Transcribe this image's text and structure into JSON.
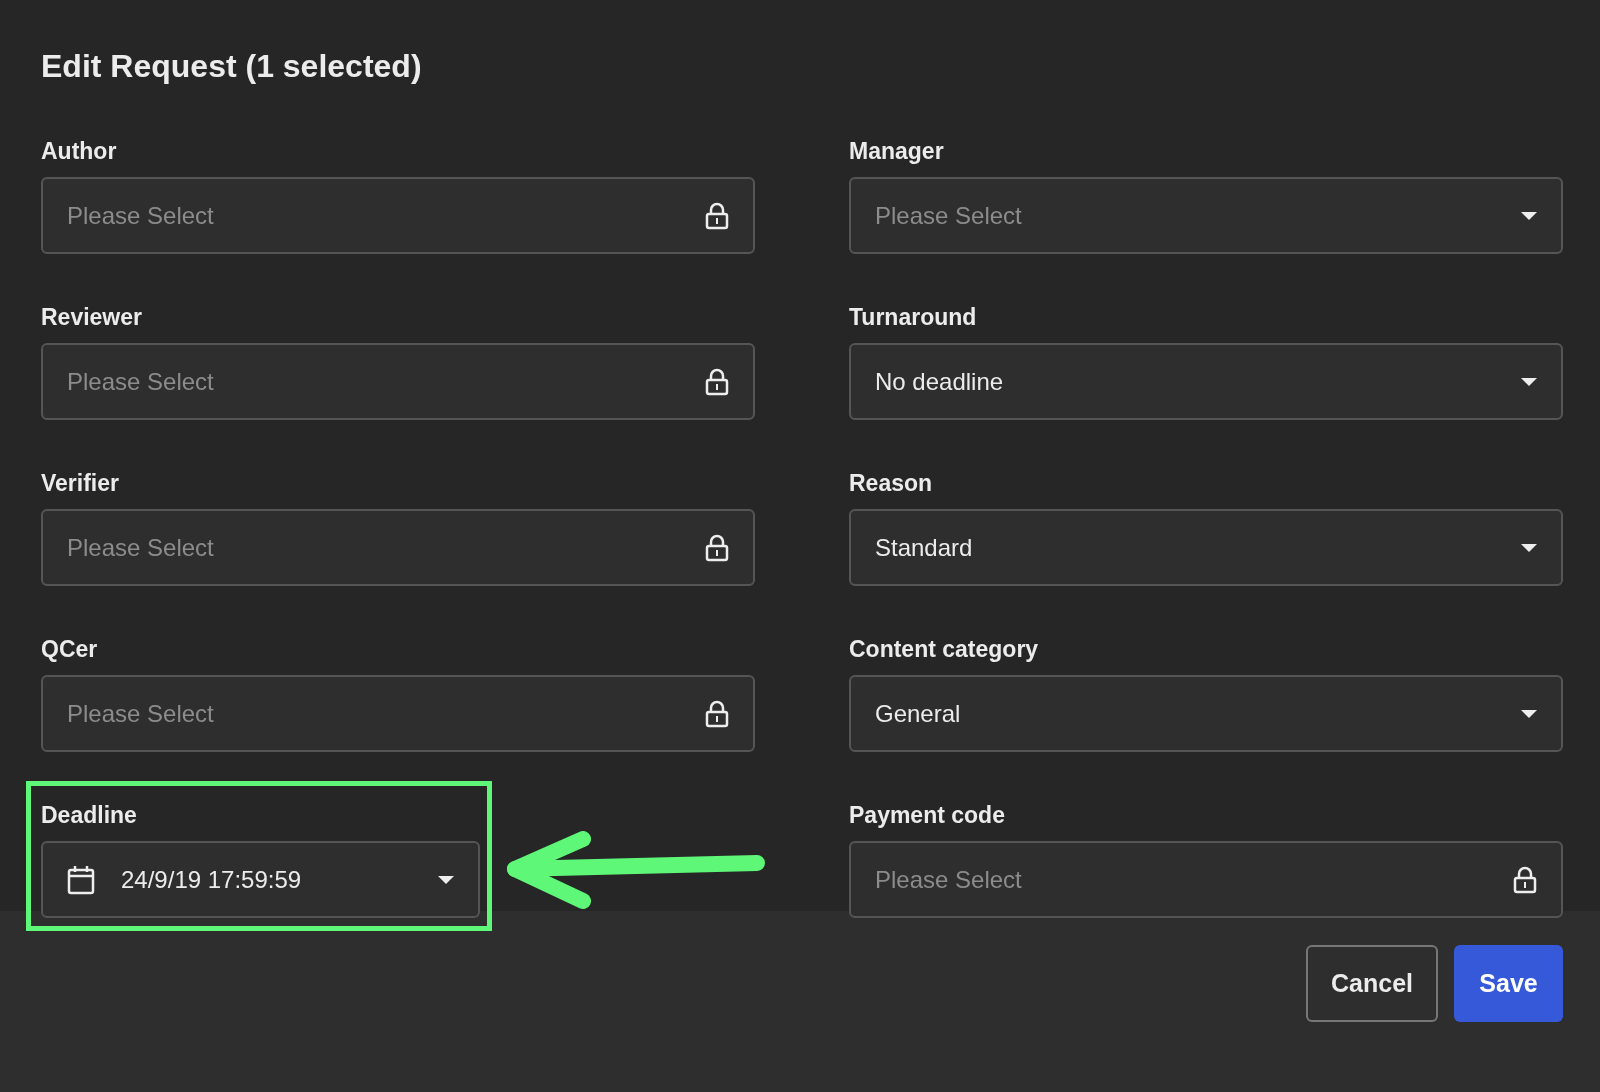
{
  "dialog": {
    "title": "Edit Request (1 selected)"
  },
  "fields": [
    {
      "label": "Author",
      "kind": "locked",
      "placeholder": "Please Select"
    },
    {
      "label": "Manager",
      "kind": "select",
      "placeholder": "Please Select"
    },
    {
      "label": "Reviewer",
      "kind": "locked",
      "placeholder": "Please Select"
    },
    {
      "label": "Turnaround",
      "kind": "select",
      "value": "No deadline"
    },
    {
      "label": "Verifier",
      "kind": "locked",
      "placeholder": "Please Select"
    },
    {
      "label": "Reason",
      "kind": "select",
      "value": "Standard"
    },
    {
      "label": "QCer",
      "kind": "locked",
      "placeholder": "Please Select"
    },
    {
      "label": "Content category",
      "kind": "select",
      "value": "General"
    },
    {
      "label": "Deadline",
      "kind": "date",
      "value": "24/9/19 17:59:59",
      "highlighted": true
    },
    {
      "label": "Payment code",
      "kind": "locked",
      "placeholder": "Please Select"
    }
  ],
  "buttons": [
    {
      "label": "Cancel",
      "kind": "secondary"
    },
    {
      "label": "Save",
      "kind": "primary"
    }
  ]
}
